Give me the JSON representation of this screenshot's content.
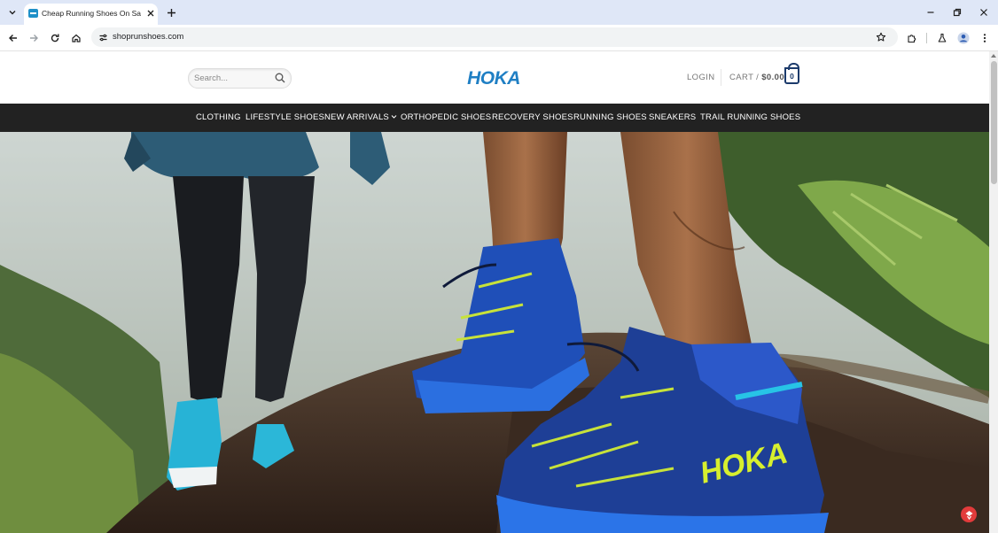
{
  "browser": {
    "tab": {
      "title": "Cheap Running Shoes On Sale"
    },
    "address_bar": {
      "url": "shoprunshoes.com"
    }
  },
  "site": {
    "search": {
      "placeholder": "Search..."
    },
    "logo_text": "HOKA",
    "account": {
      "login_label": "LOGIN"
    },
    "cart": {
      "label": "CART /",
      "amount": "$0.00",
      "count": "0"
    },
    "nav": [
      {
        "label": "CLOTHING"
      },
      {
        "label": "LIFESTYLE SHOES"
      },
      {
        "label": "NEW ARRIVALS",
        "has_dropdown": true
      },
      {
        "label": "ORTHOPEDIC SHOES"
      },
      {
        "label": "RECOVERY SHOES"
      },
      {
        "label": "RUNNING SHOES"
      },
      {
        "label": "SNEAKERS"
      },
      {
        "label": "TRAIL RUNNING SHOES"
      }
    ],
    "hero": {
      "shoe_brand_text": "HOKA"
    }
  },
  "colors": {
    "brand_blue": "#1f7fc4",
    "nav_bg": "#222222",
    "cart_blue": "#1b3a6b",
    "chat_red": "#e23b3b"
  },
  "icons": {
    "tab_search": "chevron-down-icon",
    "favicon": "site-favicon-icon",
    "tab_close": "close-icon",
    "new_tab": "plus-icon",
    "minimize": "minimize-icon",
    "restore": "restore-icon",
    "close_window": "close-icon",
    "back": "back-arrow-icon",
    "forward": "forward-arrow-icon",
    "reload": "reload-icon",
    "home": "home-icon",
    "site_info": "site-settings-icon",
    "bookmark": "star-icon",
    "extensions": "puzzle-icon",
    "labs": "flask-icon",
    "profile": "avatar-icon",
    "menu": "kebab-menu-icon",
    "search": "search-icon",
    "cart": "bag-icon",
    "chat": "chat-icon"
  }
}
